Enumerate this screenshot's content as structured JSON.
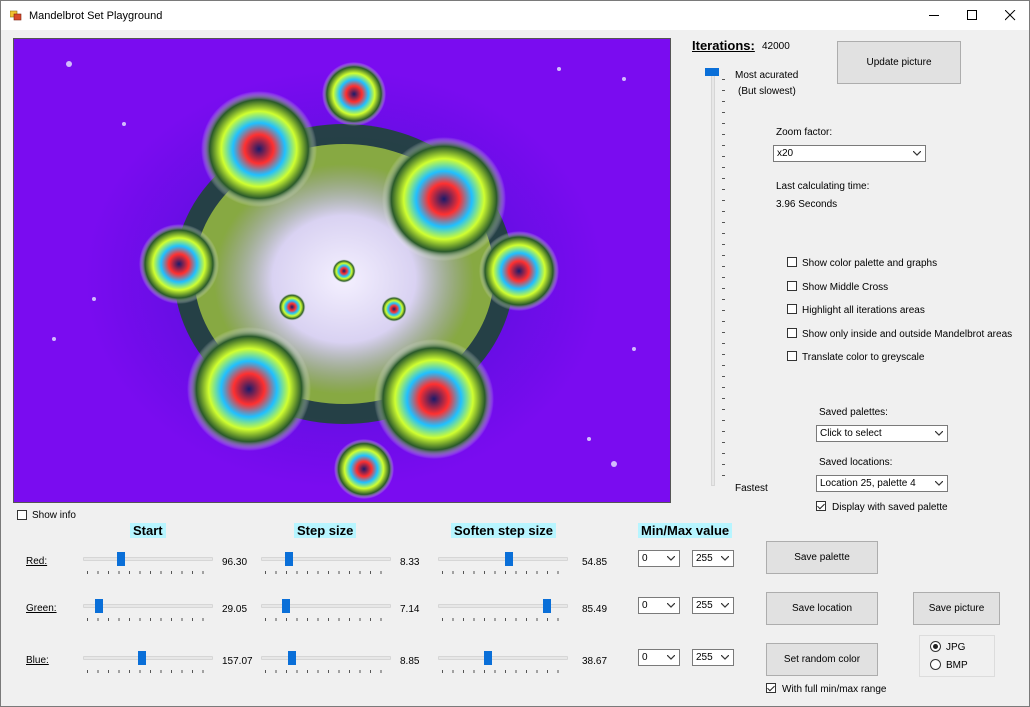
{
  "window": {
    "title": "Mandelbrot Set Playground"
  },
  "fractal": {
    "show_info_label": "Show info",
    "show_info_checked": false
  },
  "iterations": {
    "label": "Iterations:",
    "value": "42000",
    "most_label": "Most acurated",
    "most_sub_label": "(But slowest)",
    "fastest_label": "Fastest",
    "slider_level": 1.0
  },
  "update_button": "Update picture",
  "zoom": {
    "label": "Zoom factor:",
    "value": "x20"
  },
  "timing": {
    "label": "Last calculating time:",
    "value": "3.96 Seconds"
  },
  "options": [
    {
      "label": "Show color palette and graphs",
      "checked": false
    },
    {
      "label": "Show Middle Cross",
      "checked": false
    },
    {
      "label": "Highlight all iterations areas",
      "checked": false
    },
    {
      "label": "Show only inside and outside Mandelbrot areas",
      "checked": false
    },
    {
      "label": "Translate color to greyscale",
      "checked": false
    }
  ],
  "saved_palettes": {
    "label": "Saved palettes:",
    "value": "Click to select"
  },
  "saved_locations": {
    "label": "Saved locations:",
    "value": "Location 25, palette 4"
  },
  "display_saved_palette": {
    "label": "Display with saved palette",
    "checked": true
  },
  "column_headers": {
    "start": "Start",
    "step": "Step size",
    "soften": "Soften step size",
    "minmax": "Min/Max value"
  },
  "channels": [
    {
      "name": "Red:",
      "start": "96.30",
      "start_level": 0.28,
      "step": "8.33",
      "step_level": 0.2,
      "soften": "54.85",
      "soften_level": 0.55,
      "min": "0",
      "max": "255"
    },
    {
      "name": "Green:",
      "start": "29.05",
      "start_level": 0.1,
      "step": "7.14",
      "step_level": 0.17,
      "soften": "85.49",
      "soften_level": 0.86,
      "min": "0",
      "max": "255"
    },
    {
      "name": "Blue:",
      "start": "157.07",
      "start_level": 0.45,
      "step": "8.85",
      "step_level": 0.22,
      "soften": "38.67",
      "soften_level": 0.38,
      "min": "0",
      "max": "255"
    }
  ],
  "buttons": {
    "save_palette": "Save  palette",
    "save_location": "Save location",
    "save_picture": "Save picture",
    "random_color": "Set random color"
  },
  "full_range": {
    "label": "With full min/max range",
    "checked": true
  },
  "image_format": {
    "jpg_label": "JPG",
    "bmp_label": "BMP",
    "selected": "JPG"
  },
  "colors": {
    "fractal_bg": "#7a0cf0",
    "slider_thumb": "#0a6fd8",
    "header_highlight": "#b7f5ff"
  }
}
